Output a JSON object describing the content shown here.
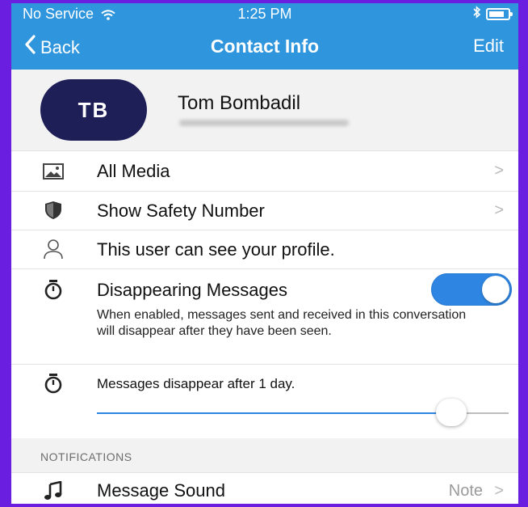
{
  "status_bar": {
    "carrier": "No Service",
    "time": "1:25 PM"
  },
  "nav": {
    "back_label": "Back",
    "title": "Contact Info",
    "edit_label": "Edit"
  },
  "profile": {
    "initials": "TB",
    "name": "Tom Bombadil"
  },
  "rows": {
    "all_media": {
      "label": "All Media",
      "icon": "photo-icon"
    },
    "safety_number": {
      "label": "Show Safety Number",
      "icon": "shield-icon"
    },
    "profile_visibility": {
      "label": "This user can see your profile.",
      "icon": "person-icon"
    },
    "disappearing": {
      "label": "Disappearing Messages",
      "icon": "timer-icon",
      "enabled": true,
      "description": "When enabled, messages sent and received in this conversation will disappear after they have been seen."
    },
    "disappear_after": {
      "label": "Messages disappear after 1 day.",
      "icon": "timer-icon",
      "slider_fraction": 0.86
    }
  },
  "notifications": {
    "header": "NOTIFICATIONS",
    "message_sound": {
      "label": "Message Sound",
      "value": "Note",
      "icon": "music-note-icon"
    }
  },
  "colors": {
    "accent": "#2f95dc",
    "toggle_on": "#2f86e2",
    "avatar_bg": "#1f1f58",
    "frame_border": "#6a1fe0"
  }
}
